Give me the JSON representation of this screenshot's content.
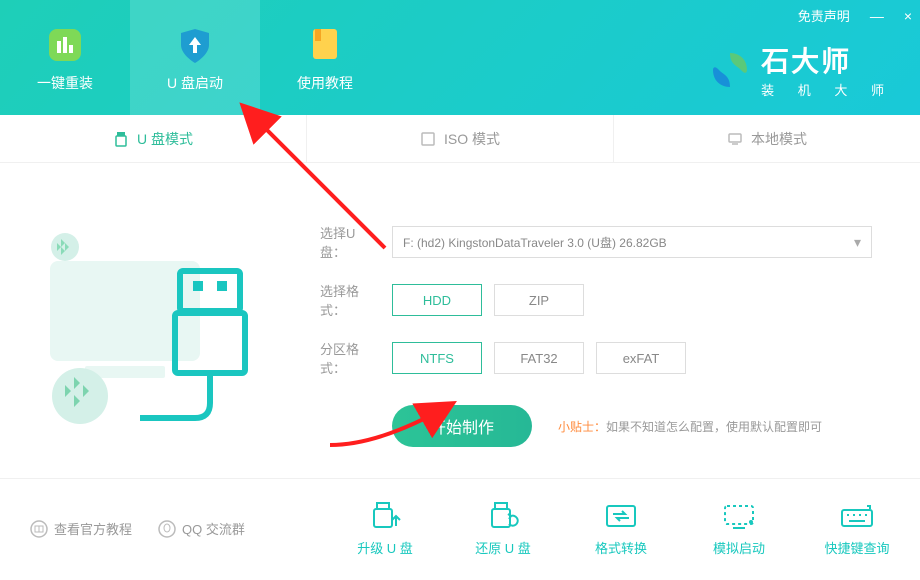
{
  "top": {
    "disclaimer": "免责声明",
    "minimize": "—",
    "close": "×"
  },
  "brand": {
    "title": "石大师",
    "sub": "装 机 大 师"
  },
  "header_tabs": [
    {
      "label": "一键重装"
    },
    {
      "label": "U 盘启动"
    },
    {
      "label": "使用教程"
    }
  ],
  "mode_tabs": [
    {
      "label": "U 盘模式"
    },
    {
      "label": "ISO 模式"
    },
    {
      "label": "本地模式"
    }
  ],
  "form": {
    "select_label": "选择U盘：",
    "select_value": "F: (hd2) KingstonDataTraveler 3.0 (U盘) 26.82GB",
    "format_label": "选择格式：",
    "format_options": [
      "HDD",
      "ZIP"
    ],
    "partition_label": "分区格式：",
    "partition_options": [
      "NTFS",
      "FAT32",
      "exFAT"
    ]
  },
  "action": {
    "primary": "开始制作",
    "tip_label": "小贴士：",
    "tip_text": "如果不知道怎么配置，使用默认配置即可"
  },
  "bottom_left": [
    {
      "label": "查看官方教程"
    },
    {
      "label": "QQ 交流群"
    }
  ],
  "bottom_actions": [
    {
      "label": "升级 U 盘"
    },
    {
      "label": "还原 U 盘"
    },
    {
      "label": "格式转换"
    },
    {
      "label": "模拟启动"
    },
    {
      "label": "快捷键查询"
    }
  ]
}
